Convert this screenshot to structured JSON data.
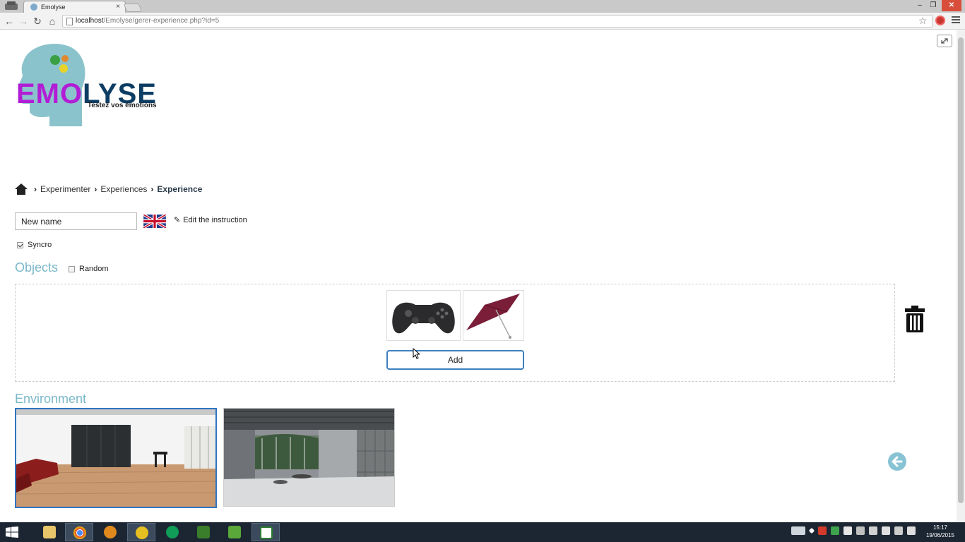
{
  "browser": {
    "tab_title": "Emolyse",
    "tab_close": "×",
    "url_host": "localhost",
    "url_path": "/Emolyse/gerer-experience.php?id=5",
    "window_controls": {
      "minimize": "–",
      "maximize": "❐",
      "close": "✕"
    },
    "nav": {
      "back": "←",
      "forward": "→",
      "reload": "↻",
      "home": "⌂",
      "star": "☆"
    }
  },
  "logo": {
    "text_emo": "EMO",
    "text_lyse": "LYSE",
    "tagline": "Testez vos émotions",
    "colors": {
      "emo": "#b21dd6",
      "lyse": "#0e3d63",
      "head": "#8bc3cc"
    }
  },
  "breadcrumb": {
    "separator": "›",
    "items": [
      "Experimenter",
      "Experiences"
    ],
    "current": "Experience"
  },
  "form": {
    "name_value": "New name",
    "edit_instruction_label": "Edit the instruction",
    "syncro_label": "Syncro",
    "syncro_checked": true
  },
  "objects": {
    "heading": "Objects",
    "random_label": "Random",
    "random_checked": false,
    "items": [
      "gamepad-image",
      "umbrella-image"
    ],
    "add_label": "Add"
  },
  "environment": {
    "heading": "Environment",
    "items": [
      "living-room-scene",
      "industrial-hall-scene"
    ],
    "selected_index": 0
  },
  "colors": {
    "heading": "#7ab8c9",
    "accent_border": "#2f74c0",
    "back_arrow": "#88c3d4"
  },
  "taskbar": {
    "apps": [
      "file-explorer",
      "chrome",
      "media-player",
      "arduino",
      "hangouts",
      "app-x",
      "camtasia-recorder",
      "camtasia-studio"
    ],
    "clock_time": "15:17",
    "clock_date": "19/06/2015"
  }
}
